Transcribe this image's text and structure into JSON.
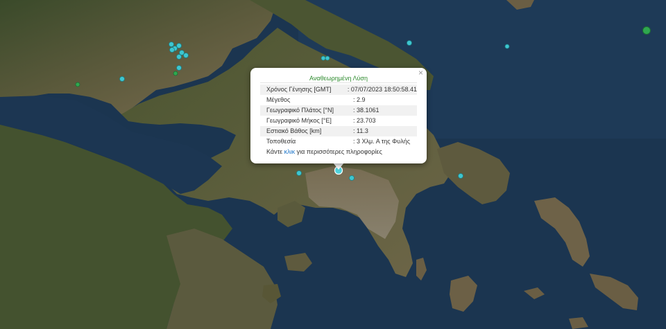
{
  "map": {
    "background_color": "#1b3550",
    "land_colors": [
      "#3d4a2c",
      "#5a5a3a",
      "#7a6a4a",
      "#8a8070"
    ],
    "marker_color": "#3ec6d0",
    "selected_marker_color": "#4fd2dc",
    "large_marker_color": "#2fa84f"
  },
  "popup": {
    "title": "Αναθεωρημένη Λύση",
    "close_glyph": "×",
    "rows": [
      {
        "label": "Χρόνος Γένησης [GMT]",
        "value": ": 07/07/2023 18:50:58.41"
      },
      {
        "label": "Μέγεθος",
        "value": ": 2.9"
      },
      {
        "label": "Γεωγραφικό Πλάτος [°N]",
        "value": ": 38.1061"
      },
      {
        "label": "Γεωγραφικό Μήκος [°E]",
        "value": ": 23.703"
      },
      {
        "label": "Εστιακό Βάθος [km]",
        "value": ": 11.3"
      },
      {
        "label": "Τοποθεσία",
        "value": ": 3 Χλμ. Α της Φυλής"
      }
    ],
    "more_prefix": "Κάντε ",
    "more_link": "κλικ",
    "more_suffix": " για περισσότερες πληροφορίες"
  }
}
